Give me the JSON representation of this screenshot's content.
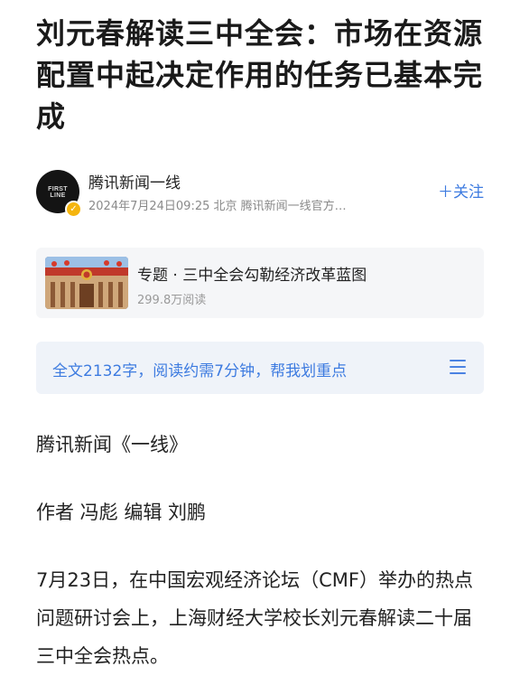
{
  "article": {
    "title": "刘元春解读三中全会：市场在资源配置中起决定作用的任务已基本完成"
  },
  "author": {
    "avatar_text": "FIRST LINE",
    "name": "腾讯新闻一线",
    "meta": "2024年7月24日09:25  北京  腾讯新闻一线官方…",
    "follow_label": "＋关注"
  },
  "topic": {
    "title": "专题 · 三中全会勾勒经济改革蓝图",
    "reads": "299.8万阅读"
  },
  "summary": {
    "text": "全文2132字，阅读约需7分钟，帮我划重点",
    "menu_icon": "menu-icon"
  },
  "body": {
    "source": "腾讯新闻《一线》",
    "byline": "作者 冯彪 编辑 刘鹏",
    "paragraph": "7月23日，在中国宏观经济论坛（CMF）举办的热点问题研讨会上，上海财经大学校长刘元春解读二十届三中全会热点。"
  },
  "colors": {
    "accent": "#3d7be0",
    "summary_bg": "#eff3f9",
    "card_bg": "#f5f6f8"
  }
}
